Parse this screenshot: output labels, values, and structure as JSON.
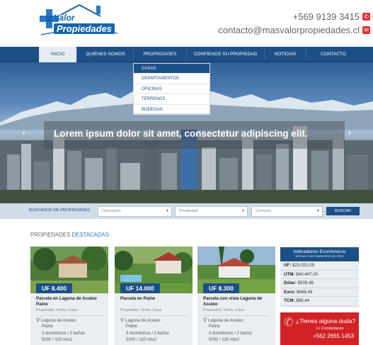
{
  "header": {
    "logo_line1": "Valor",
    "logo_line2": "Propiedades",
    "phone": "+569 9139 3415",
    "email": "contacto@masvalorpropiedades.cl",
    "phone_icon": "whatsapp-icon",
    "email_icon": "envelope-icon"
  },
  "nav": {
    "items": [
      {
        "label": "INICIO"
      },
      {
        "label": "QUIÉNES SOMOS"
      },
      {
        "label": "PROPIEDADES"
      },
      {
        "label": "CONFÍENOS SU PROPIEDAD"
      },
      {
        "label": "NOTICIAS"
      },
      {
        "label": "CONTACTO"
      }
    ],
    "active_index": 0
  },
  "dropdown": {
    "items": [
      "CASAS",
      "DEPARTAMENTOS",
      "OFICINAS",
      "TERRENOS",
      "BODEGAS"
    ]
  },
  "hero": {
    "caption": "Lorem ipsum dolor sit amet, consectetur adipiscing elit.",
    "prev": "‹",
    "next": "›"
  },
  "search": {
    "label": "BUSCADOR DE PROPIEDADES",
    "operacion": "Operación",
    "propiedad": "Propiedad",
    "comuna": "Comuna",
    "button": "BUSCAR"
  },
  "section": {
    "title_a": "PROPIEDADES",
    "title_b": "DESTACADAS"
  },
  "cards": [
    {
      "price": "UF 8.400",
      "title": "Parcela en Laguna de Aculeo Paine",
      "meta": "Propiedad, Venta, Casa",
      "loc1": "Laguna de Aculeo",
      "loc2": "Paine",
      "rooms": "3 dormitorios / 2 baños",
      "area": "5000 / 120 mts2"
    },
    {
      "price": "UF 14.000",
      "title": "Parcela en Paine",
      "meta": "Propiedad, Venta, Casa",
      "loc1": "Laguna de Aculeo",
      "loc2": "Paine",
      "rooms": "3 dormitorios / 2 baños",
      "area": "5000 / 120 mts2"
    },
    {
      "price": "UF 8.300",
      "title": "Parcela con vista Laguna de Aculeo",
      "meta": "Propiedad, Venta, Casa",
      "loc1": "Laguna de Aculeo",
      "loc2": "Paine",
      "rooms": "3 dormitorios / 2 baños",
      "area": "5000 / 120 mts2"
    }
  ],
  "indicators": {
    "title": "Indicadores Económicos",
    "date": "Viernes 6 de Septiembre de 2013",
    "rows": [
      {
        "name": "UF:",
        "value": "$23.052,09"
      },
      {
        "name": "UTM:",
        "value": "$40.447,00"
      },
      {
        "name": "Dólar:",
        "value": "$509,46"
      },
      {
        "name": "Euro:",
        "value": "$668,49"
      },
      {
        "name": "TCM:",
        "value": "$98,44"
      }
    ]
  },
  "help": {
    "title": "¿Tienes alguna duda?",
    "sub": ">> Contáctanos",
    "phone": "+562 2665 1453"
  },
  "colors": {
    "primary": "#1c4f86",
    "accent": "#2a78c8",
    "help_red": "#d12226"
  }
}
